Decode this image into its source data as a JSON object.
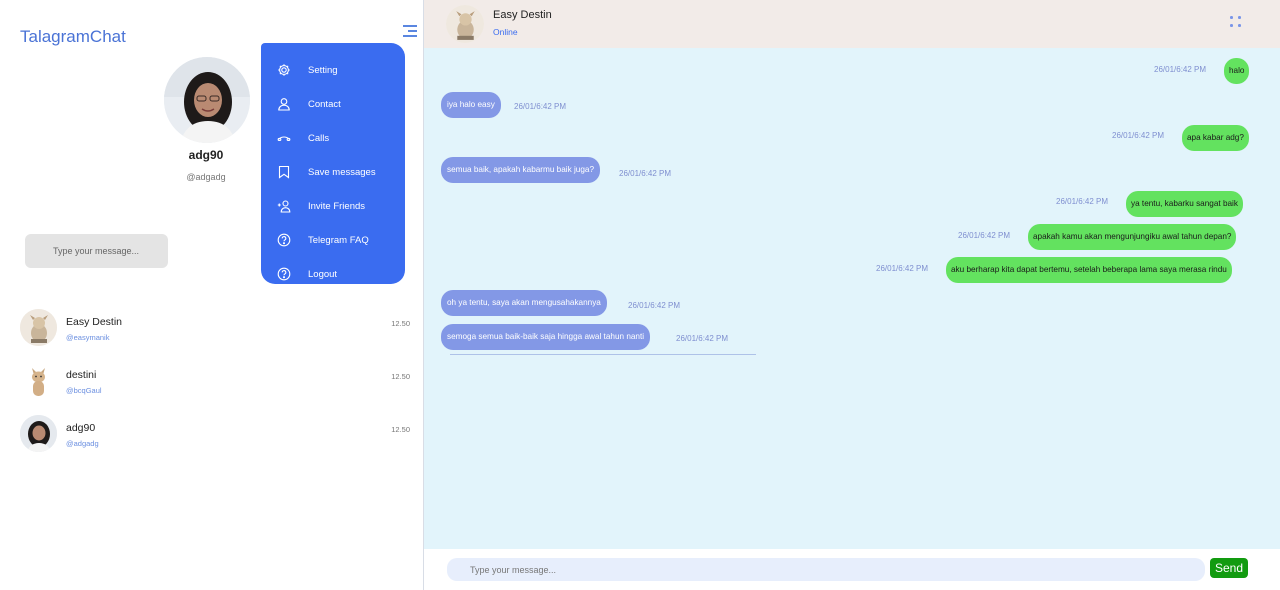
{
  "sidebar": {
    "brand": "TalagramChat",
    "profile": {
      "name": "adg90",
      "handle": "@adgadg"
    },
    "search_placeholder": "Type your message...",
    "menu": [
      {
        "label": "Setting",
        "icon": "gear-icon"
      },
      {
        "label": "Contact",
        "icon": "user-icon"
      },
      {
        "label": "Calls",
        "icon": "phone-icon"
      },
      {
        "label": "Save messages",
        "icon": "bookmark-icon"
      },
      {
        "label": "Invite Friends",
        "icon": "add-user-icon"
      },
      {
        "label": "Telegram FAQ",
        "icon": "help-icon"
      },
      {
        "label": "Logout",
        "icon": "logout-icon"
      }
    ],
    "contacts": [
      {
        "name": "Easy Destin",
        "handle": "@easymanik",
        "time": "12.50"
      },
      {
        "name": "destini",
        "handle": "@bcqGaul",
        "time": "12.50"
      },
      {
        "name": "adg90",
        "handle": "@adgadg",
        "time": "12.50"
      }
    ]
  },
  "chat": {
    "header": {
      "name": "Easy Destin",
      "status": "Online"
    },
    "messages": [
      {
        "dir": "out",
        "text": "halo",
        "time": "26/01/6:42 PM"
      },
      {
        "dir": "in",
        "text": "iya halo easy",
        "time": "26/01/6:42 PM"
      },
      {
        "dir": "out",
        "text": "apa kabar adg?",
        "time": "26/01/6:42 PM"
      },
      {
        "dir": "in",
        "text": "semua baik, apakah kabarmu baik juga?",
        "time": "26/01/6:42 PM"
      },
      {
        "dir": "out",
        "text": "ya tentu, kabarku sangat baik",
        "time": "26/01/6:42 PM"
      },
      {
        "dir": "out",
        "text": "apakah kamu akan mengunjungiku awal tahun depan?",
        "time": "26/01/6:42 PM"
      },
      {
        "dir": "out",
        "text": "aku berharap kita dapat bertemu, setelah beberapa lama saya merasa rindu",
        "time": "26/01/6:42 PM"
      },
      {
        "dir": "in",
        "text": "oh ya tentu, saya akan mengusahakannya",
        "time": "26/01/6:42 PM"
      },
      {
        "dir": "in",
        "text": "semoga semua baik-baik saja hingga awal tahun nanti",
        "time": "26/01/6:42 PM"
      }
    ],
    "composer": {
      "placeholder": "Type your message...",
      "send_label": "Send"
    }
  },
  "colors": {
    "accent": "#3a6cf0",
    "outgoing": "#63e25f",
    "incoming": "#8398e6",
    "send": "#129b10",
    "chat_bg": "#e2f4fb"
  }
}
